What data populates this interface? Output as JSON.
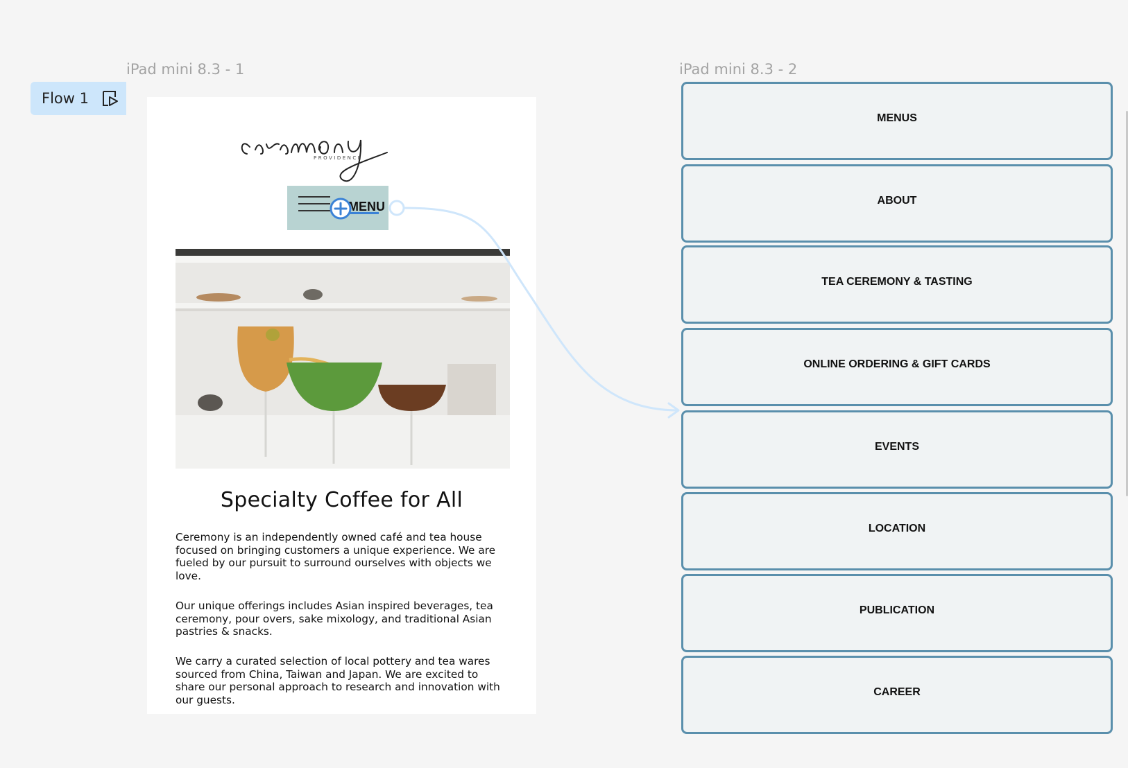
{
  "frames": {
    "frame1_label": "iPad mini 8.3 - 1",
    "frame2_label": "iPad mini 8.3 - 2"
  },
  "flow": {
    "label": "Flow 1"
  },
  "page": {
    "logo_text": "ceremony",
    "logo_subtitle": "PROVIDENCE",
    "menu_button_label": "MENU",
    "title": "Specialty Coffee for All",
    "paragraphs": [
      "Ceremony is an independently owned café and tea house focused on bringing customers a unique experience. We are fueled by our pursuit to surround ourselves with objects we love.",
      "Our unique offerings includes Asian inspired beverages, tea ceremony, pour overs, sake mixology, and traditional Asian pastries & snacks.",
      "We carry a curated selection of local pottery and tea wares sourced from China, Taiwan and Japan. We are excited to share our personal approach to research and innovation with our guests."
    ]
  },
  "nav_menu": [
    "MENUS",
    "ABOUT",
    "TEA CEREMONY & TASTING",
    "ONLINE ORDERING & GIFT CARDS",
    "EVENTS",
    "LOCATION",
    "PUBLICATION",
    "CAREER"
  ],
  "colors": {
    "canvas": "#f5f5f5",
    "flow_badge": "#cde6fb",
    "menu_button": "#b8d3d2",
    "nav_border": "#5a8fac",
    "nav_fill": "#f0f3f4",
    "connector": "#cfe6fb",
    "hotspot": "#3b82d6"
  }
}
